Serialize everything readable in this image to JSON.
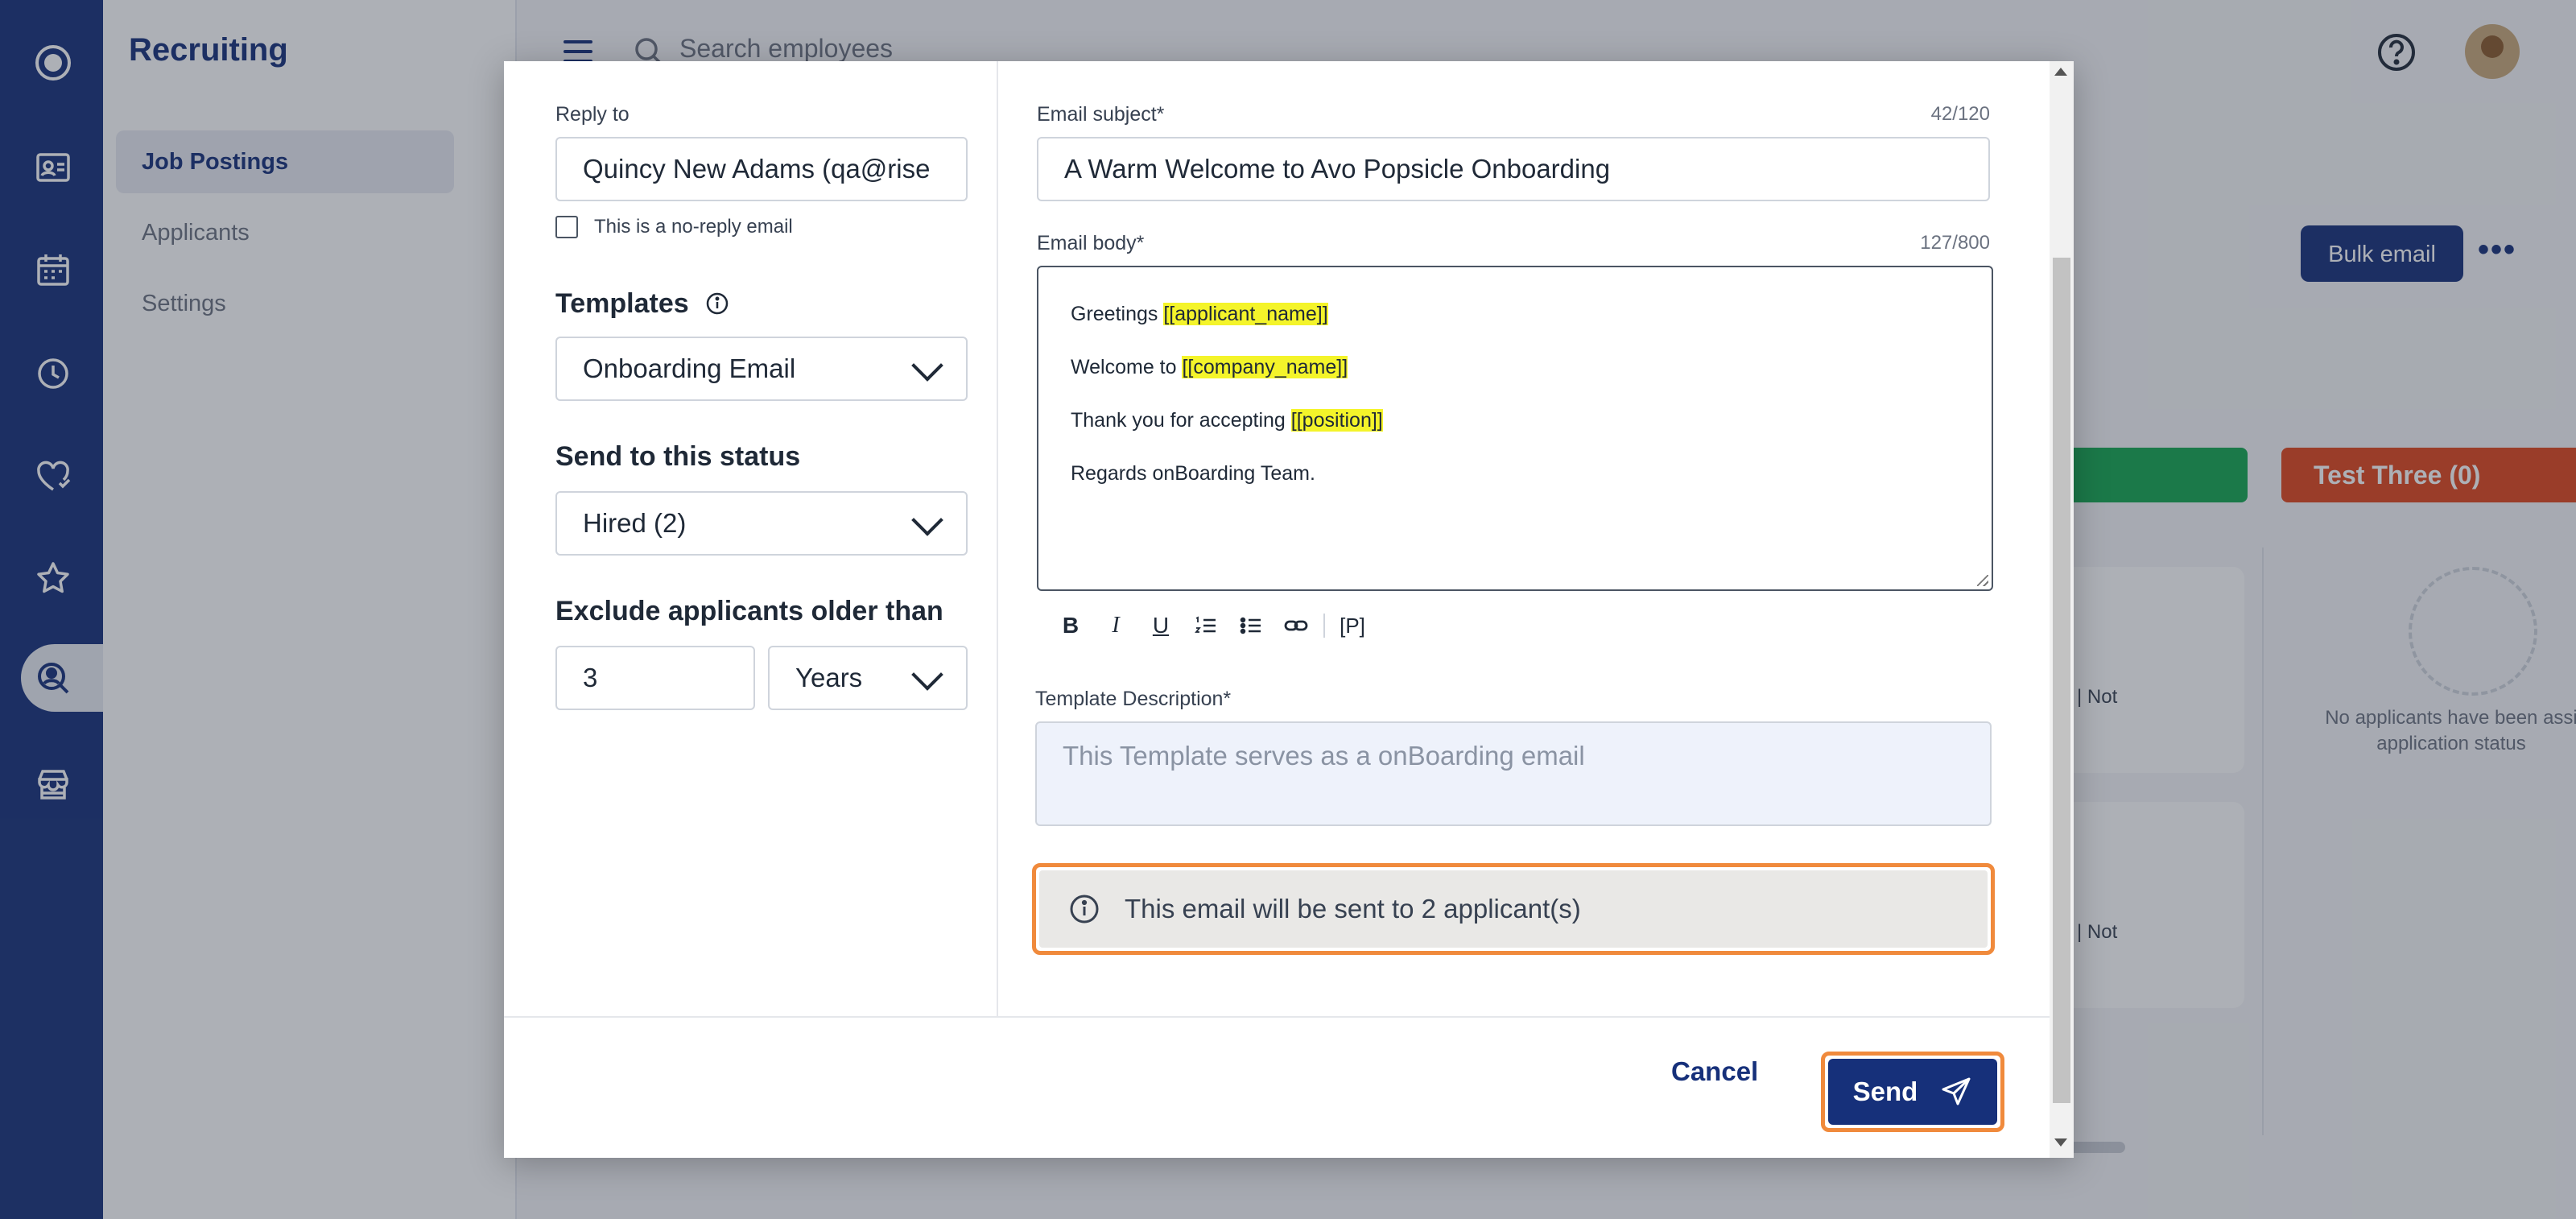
{
  "app": {
    "section_title": "Recruiting",
    "nav": [
      {
        "label": "Job Postings",
        "active": true
      },
      {
        "label": "Applicants",
        "active": false
      },
      {
        "label": "Settings",
        "active": false
      }
    ],
    "rail_icons": [
      "logo-icon",
      "id-card-icon",
      "calendar-icon",
      "clock-icon",
      "heart-icon",
      "star-icon",
      "search-user-icon",
      "store-icon"
    ]
  },
  "header": {
    "search_placeholder": "Search employees"
  },
  "background": {
    "bulk_email_label": "Bulk email",
    "column_red_label": "Test Three (0)",
    "card_text_1": "| Not",
    "card_text_2": "| Not",
    "empty_text": "No applicants have been assi application status"
  },
  "modal": {
    "reply_to": {
      "label": "Reply to",
      "value": "Quincy New Adams (qa@rise",
      "no_reply_label": "This is a no-reply email",
      "no_reply_checked": false
    },
    "templates": {
      "label": "Templates",
      "selected": "Onboarding Email"
    },
    "send_status": {
      "label": "Send to this status",
      "selected": "Hired (2)"
    },
    "exclude": {
      "label": "Exclude applicants older than",
      "value": "3",
      "unit": "Years"
    },
    "subject": {
      "label": "Email subject*",
      "counter": "42/120",
      "value": "A Warm Welcome to Avo Popsicle Onboarding"
    },
    "body": {
      "label": "Email body*",
      "counter": "127/800",
      "lines": [
        {
          "text": "Greetings ",
          "token": "[[applicant_name]]"
        },
        {
          "text": "Welcome to ",
          "token": "[[company_name]]"
        },
        {
          "text": "Thank you for accepting ",
          "token": "[[position]]"
        },
        {
          "text": "Regards onBoarding Team.",
          "token": ""
        }
      ]
    },
    "toolbar": {
      "bold": "B",
      "italic": "I",
      "underline": "U",
      "placeholder": "[P]"
    },
    "description": {
      "label": "Template Description*",
      "placeholder": "This Template serves as a onBoarding email"
    },
    "notice": "This email will be sent to 2 applicant(s)",
    "cancel_label": "Cancel",
    "send_label": "Send"
  },
  "colors": {
    "brand": "#16307a",
    "highlight": "#f08a3c",
    "token_highlight": "#f4f42a",
    "status_green": "#14a650",
    "status_red": "#e0461c"
  }
}
